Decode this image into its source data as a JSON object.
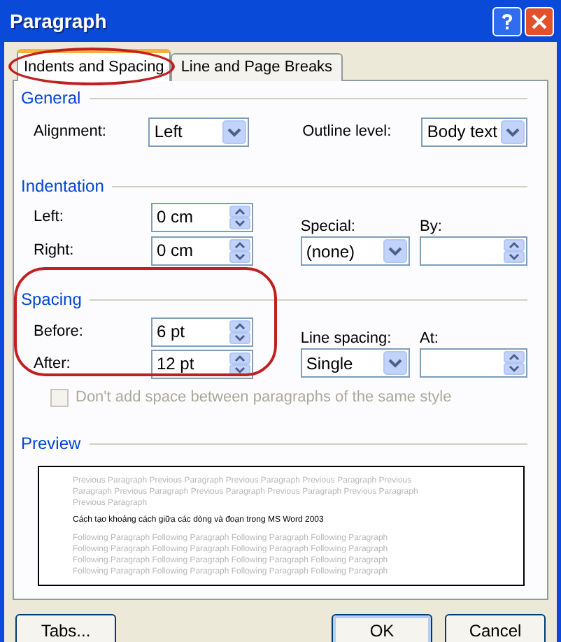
{
  "window": {
    "title": "Paragraph"
  },
  "tabs": [
    {
      "label": "Indents and Spacing",
      "selected": true,
      "highlighted": true
    },
    {
      "label": "Line and Page Breaks",
      "selected": false,
      "highlighted": false
    }
  ],
  "general": {
    "title": "General",
    "alignment": {
      "label": "Alignment:",
      "value": "Left"
    },
    "outline_level": {
      "label": "Outline level:",
      "value": "Body text"
    }
  },
  "indentation": {
    "title": "Indentation",
    "left": {
      "label": "Left:",
      "value": "0 cm"
    },
    "right": {
      "label": "Right:",
      "value": "0 cm"
    },
    "special": {
      "label": "Special:",
      "value": "(none)"
    },
    "by": {
      "label": "By:"
    }
  },
  "spacing": {
    "title": "Spacing",
    "highlighted": true,
    "before": {
      "label": "Before:",
      "value": "6 pt"
    },
    "after": {
      "label": "After:",
      "value": "12 pt"
    },
    "line_spacing": {
      "label": "Line spacing:",
      "value": "Single"
    },
    "at": {
      "label": "At:"
    },
    "checkbox": {
      "label": "Don't add space between paragraphs of the same style",
      "checked": false,
      "disabled": true
    }
  },
  "preview": {
    "title": "Preview",
    "previous_lines": [
      "Previous Paragraph Previous Paragraph Previous Paragraph Previous Paragraph Previous",
      "Paragraph Previous Paragraph Previous Paragraph Previous Paragraph Previous Paragraph",
      "Previous Paragraph"
    ],
    "sample": "Cách tạo khoảng cách giữa các dòng và đoạn trong MS Word 2003",
    "following_lines": [
      "Following Paragraph Following Paragraph Following Paragraph Following Paragraph",
      "Following Paragraph Following Paragraph Following Paragraph Following Paragraph",
      "Following Paragraph Following Paragraph Following Paragraph Following Paragraph",
      "Following Paragraph Following Paragraph Following Paragraph Following Paragraph"
    ]
  },
  "buttons": [
    {
      "label": "Tabs..."
    },
    {
      "label": "OK"
    },
    {
      "label": "Cancel"
    }
  ]
}
